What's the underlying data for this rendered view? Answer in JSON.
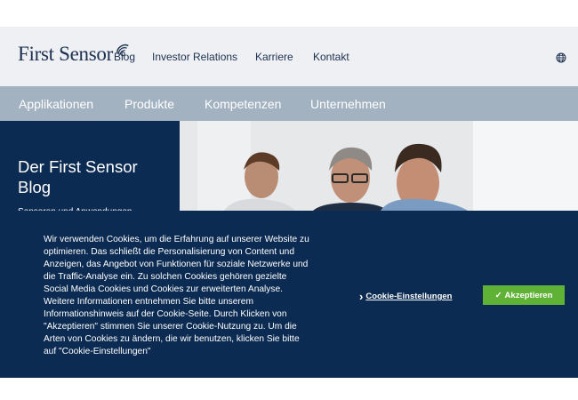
{
  "brand": {
    "logo_text": "First Sensor"
  },
  "top_nav": [
    {
      "label": "Blog"
    },
    {
      "label": "Investor Relations"
    },
    {
      "label": "Karriere"
    },
    {
      "label": "Kontakt"
    }
  ],
  "main_nav": [
    {
      "label": "Applikationen"
    },
    {
      "label": "Produkte"
    },
    {
      "label": "Kompetenzen"
    },
    {
      "label": "Unternehmen"
    }
  ],
  "hero": {
    "title": "Der First Sensor Blog",
    "subtitle": "Sensoren und Anwendungen"
  },
  "cookie_banner": {
    "text": "Wir verwenden Cookies, um die Erfahrung auf unserer Website zu optimieren. Das schließt die Personalisierung von Content und Anzeigen, das Angebot von Funktionen für soziale Netzwerke und die Traffic-Analyse ein. Zu solchen Cookies gehören gezielte Social Media Cookies und Cookies zur erweiterten Analyse. Weitere Informationen entnehmen Sie bitte unserem Informationshinweis auf der Cookie-Seite. Durch Klicken von \"Akzeptieren\" stimmen Sie unserer Cookie-Nutzung zu. Um die Arten von Cookies zu ändern, die wir benutzen, klicken Sie bitte auf \"Cookie-Einstellungen\"",
    "settings_label": "Cookie-Einstellungen",
    "accept_label": "Akzeptieren"
  },
  "colors": {
    "navy": "#0c2b52",
    "nav_bar": "#a3b2c1",
    "top_bar": "#eef0f3",
    "accept_green": "#5fb236"
  },
  "icons": {
    "logo_mark": "spiral-logo-icon",
    "globe": "globe-icon",
    "settings_chevron": "chevron-right-icon",
    "accept_check": "check-icon"
  }
}
